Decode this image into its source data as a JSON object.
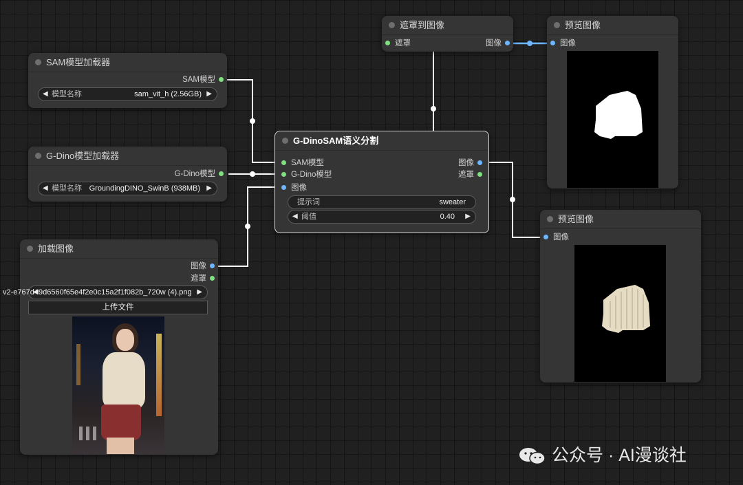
{
  "nodes": {
    "sam_loader": {
      "title": "SAM模型加载器",
      "output": "SAM模型",
      "widget": {
        "label": "模型名称",
        "value": "sam_vit_h (2.56GB)"
      }
    },
    "gdino_loader": {
      "title": "G-Dino模型加载器",
      "output": "G-Dino模型",
      "widget": {
        "label": "模型名称",
        "value": "GroundingDINO_SwinB (938MB)"
      }
    },
    "load_image": {
      "title": "加载图像",
      "outputs": [
        "图像",
        "遮罩"
      ],
      "file_value": "v2-e767d49d6560f65e4f2e0c15a2f1f082b_720w (4).png",
      "upload_label": "上传文件"
    },
    "gdino_sam": {
      "title": "G-DinoSAM语义分割",
      "inputs": [
        "SAM模型",
        "G-Dino模型",
        "图像"
      ],
      "outputs": [
        "图像",
        "遮罩"
      ],
      "prompt": {
        "label": "提示词",
        "value": "sweater"
      },
      "threshold": {
        "label": "阈值",
        "value": "0.40"
      }
    },
    "mask_to_image": {
      "title": "遮罩到图像",
      "input": "遮罩",
      "output": "图像"
    },
    "preview_top": {
      "title": "预览图像",
      "input": "图像"
    },
    "preview_bottom": {
      "title": "预览图像",
      "input": "图像"
    }
  },
  "watermark": "公众号 · AI漫谈社",
  "colors": {
    "image_slot": "#6eb6ff",
    "model_slot": "#7fe07f",
    "wire": "#ffffff",
    "image_wire": "#6eb6ff",
    "canvas": "#202020",
    "node": "#353535"
  },
  "icons": [
    "collapse-dot",
    "left-arrow-icon",
    "right-arrow-icon",
    "wechat-icon"
  ]
}
